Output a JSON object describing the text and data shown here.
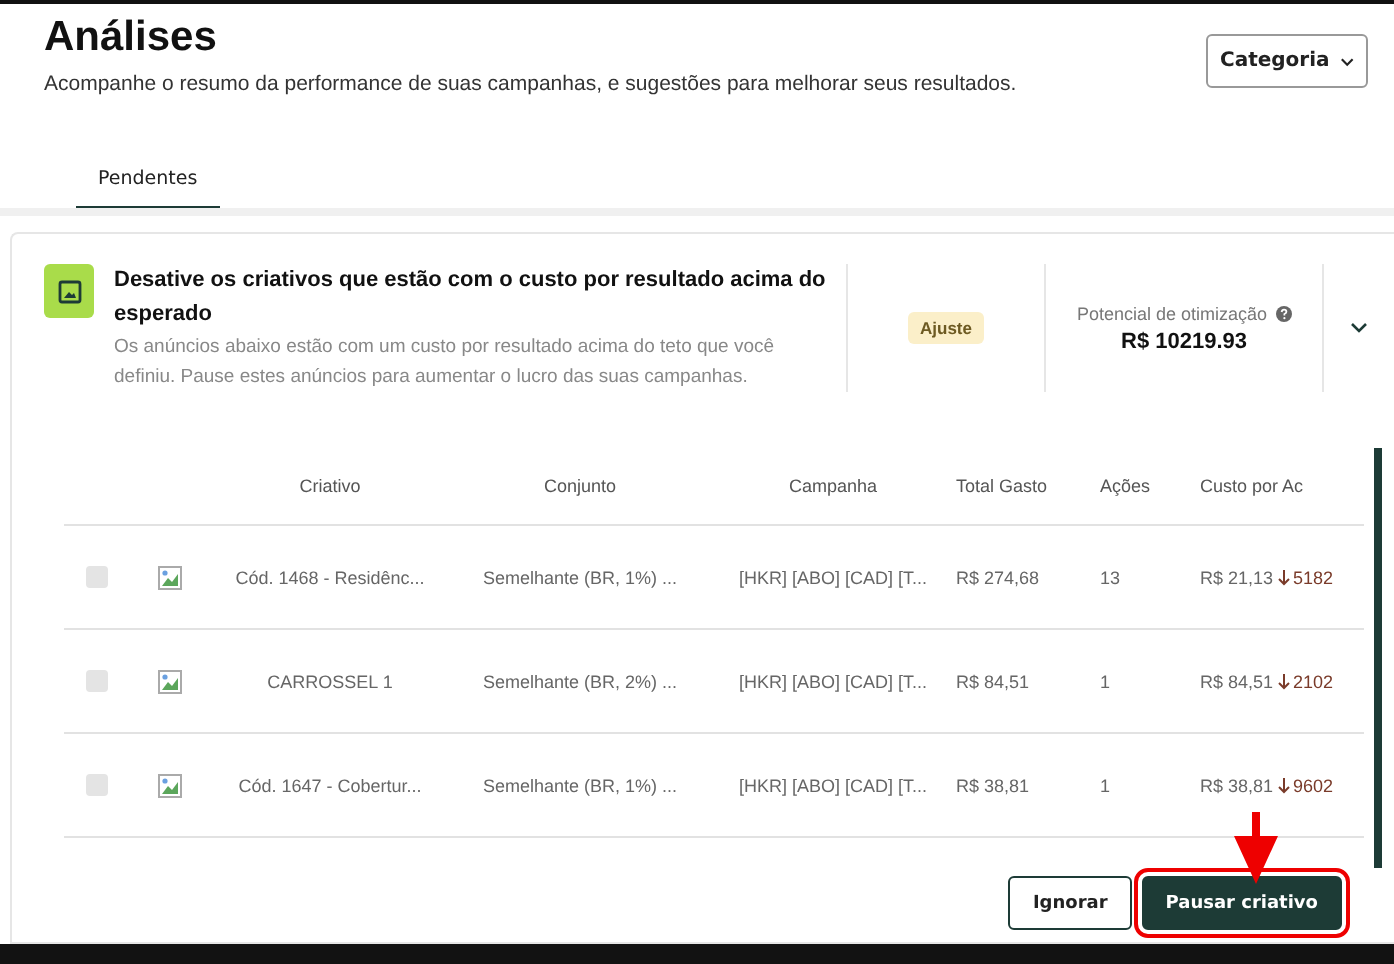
{
  "header": {
    "title": "Análises",
    "subtitle": "Acompanhe o resumo da performance de suas campanhas, e sugestões para melhorar seus resultados.",
    "category_button": "Categoria"
  },
  "tabs": [
    {
      "label": "Pendentes",
      "selected": true
    }
  ],
  "suggestion": {
    "title": "Desative os criativos que estão com o custo por resultado acima do esperado",
    "description": "Os anúncios abaixo estão com um custo por resultado acima do teto que você definiu. Pause estes anúncios para aumentar o lucro das suas campanhas.",
    "badge": "Ajuste",
    "potential_label": "Potencial de otimização",
    "potential_value": "R$ 10219.93",
    "expanded": true
  },
  "table": {
    "columns": [
      "Criativo",
      "Conjunto",
      "Campanha",
      "Total Gasto",
      "Ações",
      "Custo por Ac"
    ],
    "rows": [
      {
        "checked": false,
        "creative": "Cód. 1468 - Residênc...",
        "set": "Semelhante (BR, 1%) ...",
        "campaign": "[HKR] [ABO] [CAD] [T...",
        "spent": "R$ 274,68",
        "actions": "13",
        "cost": "R$ 21,13",
        "change": "5182"
      },
      {
        "checked": false,
        "creative": "CARROSSEL 1",
        "set": "Semelhante (BR, 2%) ...",
        "campaign": "[HKR] [ABO] [CAD] [T...",
        "spent": "R$ 84,51",
        "actions": "1",
        "cost": "R$ 84,51",
        "change": "2102"
      },
      {
        "checked": false,
        "creative": "Cód. 1647 - Cobertur...",
        "set": "Semelhante (BR, 1%) ...",
        "campaign": "[HKR] [ABO] [CAD] [T...",
        "spent": "R$ 38,81",
        "actions": "1",
        "cost": "R$ 38,81",
        "change": "9602"
      }
    ]
  },
  "buttons": [
    {
      "label": "Ignorar",
      "kind": "secondary"
    },
    {
      "label": "Pausar criativo",
      "kind": "primary",
      "highlighted": true
    }
  ]
}
